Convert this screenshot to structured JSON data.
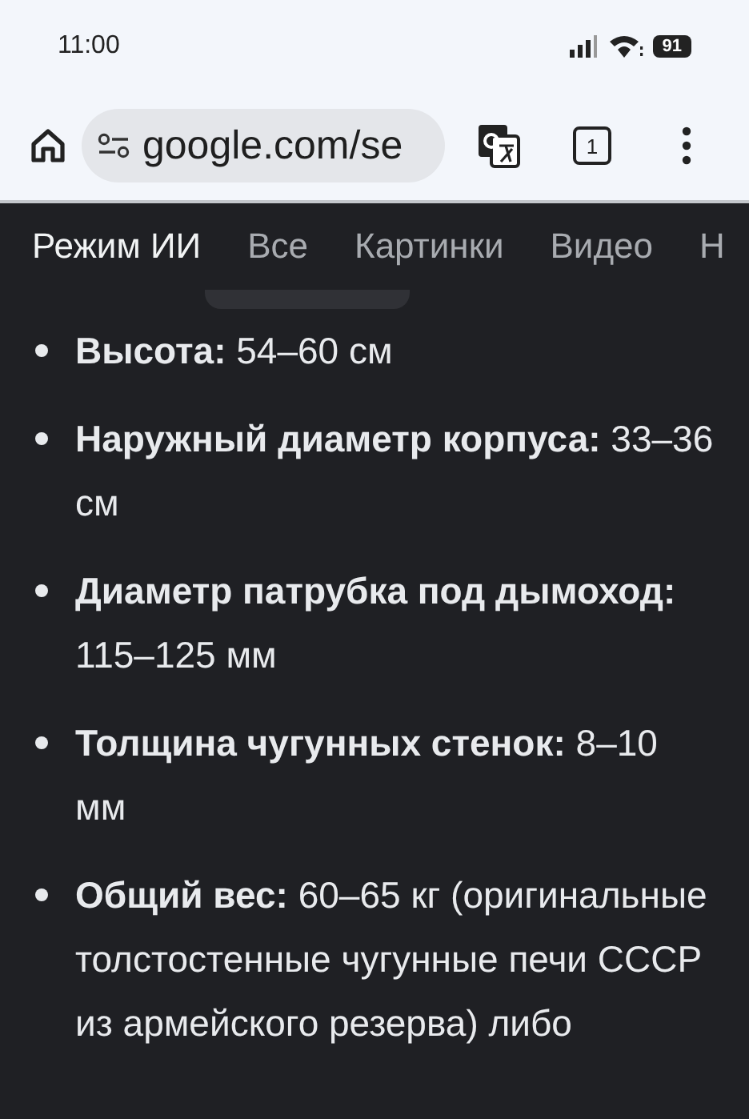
{
  "status_bar": {
    "time": "11:00",
    "battery": "91"
  },
  "address_bar": {
    "url": "google.com/se",
    "tab_count": "1"
  },
  "tabs": [
    {
      "label": "Режим ИИ",
      "selected": true
    },
    {
      "label": "Все",
      "selected": false
    },
    {
      "label": "Картинки",
      "selected": false
    },
    {
      "label": "Видео",
      "selected": false
    },
    {
      "label": "Н",
      "selected": false
    }
  ],
  "bullets": [
    "**Высота:** 54–60 см",
    "**Наружный диаметр корпуса:** 33–36 см",
    "**Диаметр патрубка под дымоход:** 115–125 мм",
    "**Толщина чугунных стенок:** 8–10 мм",
    "**Общий вес:** 60–65 кг (оригинальные толстостенные чугунные печи СССР из армейского резерва) либо"
  ]
}
